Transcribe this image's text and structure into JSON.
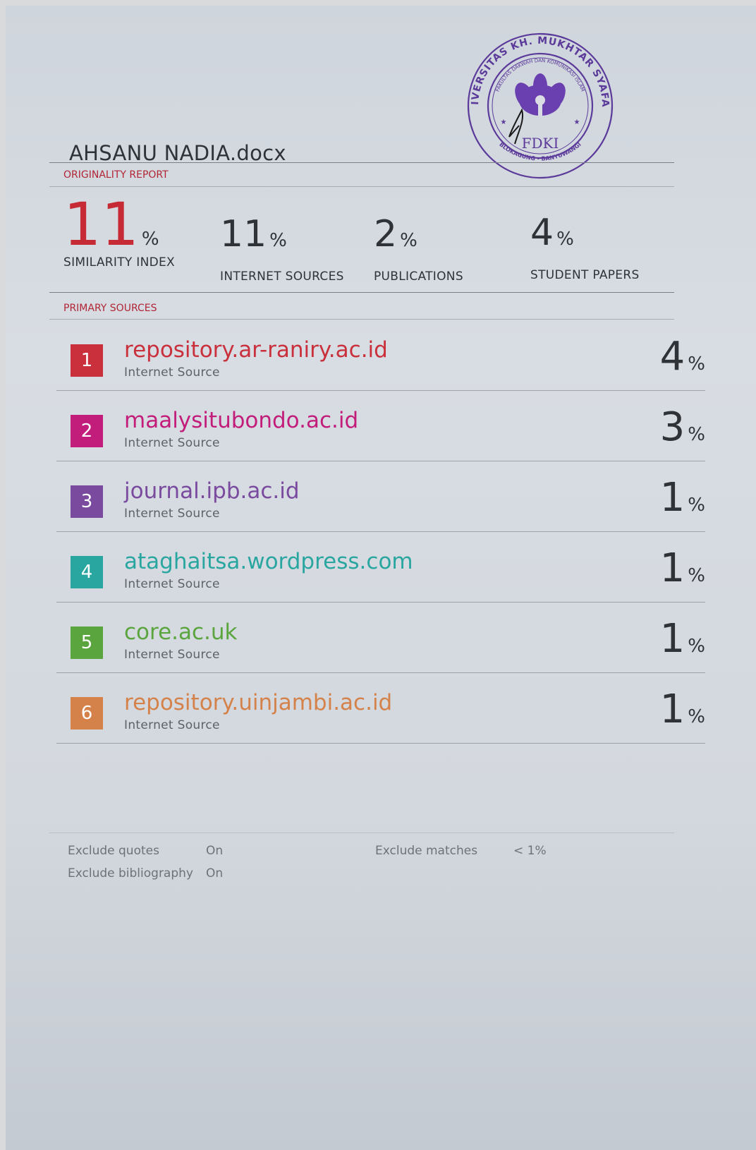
{
  "document": {
    "filename": "AHSANU NADIA.docx",
    "report_label": "ORIGINALITY REPORT"
  },
  "stamp": {
    "outer_text": "UNIVERSITAS KH. MUKHTAR SYAFAAT",
    "inner_text": "FAKULTAS DAKWAH DAN KOMUNIKASI ISLAM",
    "center_text": "FDKI",
    "bottom_text": "BLOKAGUNG - BANYUWANGI",
    "color": "#5b3a9a"
  },
  "stats": [
    {
      "value": "11",
      "unit": "%",
      "label": "SIMILARITY INDEX"
    },
    {
      "value": "11",
      "unit": "%",
      "label": "INTERNET SOURCES"
    },
    {
      "value": "2",
      "unit": "%",
      "label": "PUBLICATIONS"
    },
    {
      "value": "4",
      "unit": "%",
      "label": "STUDENT PAPERS"
    }
  ],
  "primary_sources_label": "PRIMARY SOURCES",
  "sources": [
    {
      "rank": "1",
      "name": "repository.ar-raniry.ac.id",
      "type": "Internet Source",
      "percent": "4",
      "unit": "%",
      "color": "#c9303c"
    },
    {
      "rank": "2",
      "name": "maalysitubondo.ac.id",
      "type": "Internet Source",
      "percent": "3",
      "unit": "%",
      "color": "#c21d7a"
    },
    {
      "rank": "3",
      "name": "journal.ipb.ac.id",
      "type": "Internet Source",
      "percent": "1",
      "unit": "%",
      "color": "#7a4a9e"
    },
    {
      "rank": "4",
      "name": "ataghaitsa.wordpress.com",
      "type": "Internet Source",
      "percent": "1",
      "unit": "%",
      "color": "#2aa6a0"
    },
    {
      "rank": "5",
      "name": "core.ac.uk",
      "type": "Internet Source",
      "percent": "1",
      "unit": "%",
      "color": "#5ba53e"
    },
    {
      "rank": "6",
      "name": "repository.uinjambi.ac.id",
      "type": "Internet Source",
      "percent": "1",
      "unit": "%",
      "color": "#d5824a"
    }
  ],
  "settings": {
    "exclude_quotes_label": "Exclude quotes",
    "exclude_quotes_value": "On",
    "exclude_bibliography_label": "Exclude bibliography",
    "exclude_bibliography_value": "On",
    "exclude_matches_label": "Exclude matches",
    "exclude_matches_value": "< 1%"
  }
}
